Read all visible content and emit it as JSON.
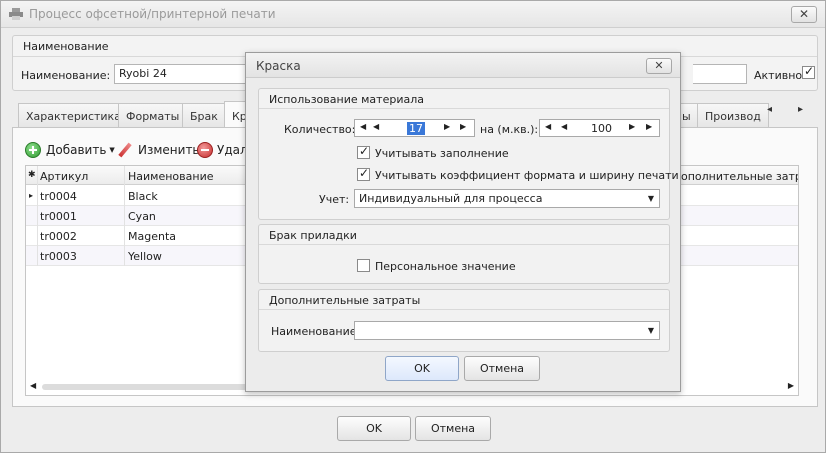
{
  "window": {
    "title": "Процесс офсетной/принтерной печати",
    "close_glyph": "✕"
  },
  "name_group": {
    "caption": "Наименование",
    "name_label": "Наименование:",
    "name_value": "Ryobi 24",
    "active_label": "Активно",
    "active_checked": true
  },
  "tabs": [
    {
      "label": "Характеристика"
    },
    {
      "label": "Форматы"
    },
    {
      "label": "Брак"
    },
    {
      "label": "Кр"
    },
    {
      "label": "ы"
    },
    {
      "label": "Производ"
    }
  ],
  "tab_nav": {
    "prev": "◂",
    "next": "▸"
  },
  "toolbar": {
    "add_label": "Добавить",
    "edit_label": "Изменить",
    "delete_label": "Удал"
  },
  "grid": {
    "columns": [
      "Артикул",
      "Наименование",
      "ополнительные затра"
    ],
    "row_marker": "▸",
    "head_marker": "✱",
    "rows": [
      {
        "code": "tr0004",
        "name": "Black"
      },
      {
        "code": "tr0001",
        "name": "Cyan"
      },
      {
        "code": "tr0002",
        "name": "Magenta"
      },
      {
        "code": "tr0003",
        "name": "Yellow"
      }
    ]
  },
  "footer": {
    "ok_label": "OK",
    "cancel_label": "Отмена"
  },
  "dialog": {
    "title": "Краска",
    "close_glyph": "✕",
    "usage_group": {
      "caption": "Использование материала",
      "qty_label": "Количество:",
      "qty_value": "17",
      "per_label": "на (м.кв.):",
      "per_value": "100",
      "fill_label": "Учитывать заполнение",
      "fill_checked": true,
      "format_label": "Учитывать коэффициент формата и ширину печати",
      "format_checked": true,
      "account_label": "Учет:",
      "account_value": "Индивидуальный для процесса"
    },
    "waste_group": {
      "caption": "Брак приладки",
      "personal_label": "Персональное значение",
      "personal_checked": false
    },
    "extra_group": {
      "caption": "Дополнительные затраты",
      "name_label": "Наименование:",
      "name_value": ""
    },
    "ok_label": "OK",
    "cancel_label": "Отмена"
  }
}
